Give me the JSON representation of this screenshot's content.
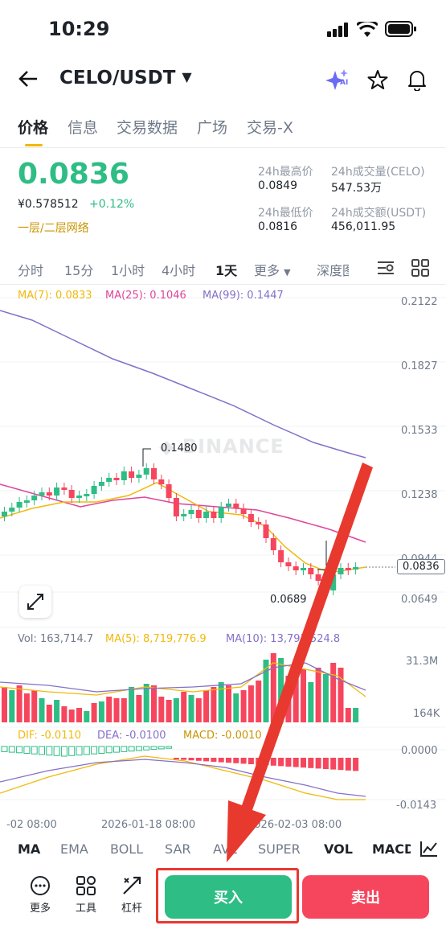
{
  "status": {
    "time": "10:29"
  },
  "header": {
    "pair": "CELO/USDT",
    "dropdown_icon": "caret-down-icon",
    "ai_badge": "AI"
  },
  "tabs": [
    "价格",
    "信息",
    "交易数据",
    "广场",
    "交易-X"
  ],
  "market": {
    "price": "0.0836",
    "cny_price": "¥0.578512",
    "change": "+0.12%",
    "network": "一层/二层网络",
    "high_label": "24h最高价",
    "high_value": "0.0849",
    "low_label": "24h最低价",
    "low_value": "0.0816",
    "vol_celo_label": "24h成交量(CELO)",
    "vol_celo_value": "547.53万",
    "vol_usdt_label": "24h成交额(USDT)",
    "vol_usdt_value": "456,011.95"
  },
  "timeframes": [
    "分时",
    "15分",
    "1小时",
    "4小时",
    "1天",
    "更多",
    "深度图"
  ],
  "chart": {
    "ma_legend": {
      "ma7": "MA(7): 0.0833",
      "ma25": "MA(25): 0.1046",
      "ma99": "MA(99): 0.1447"
    },
    "price_axis": [
      "0.2122",
      "0.1827",
      "0.1533",
      "0.1238",
      "0.0944",
      "0.0649"
    ],
    "current_price_tag": "0.0836",
    "high_marker": "0.1480",
    "low_marker": "0.0689",
    "watermark": "BINANCE",
    "vol_legend": {
      "vol": "Vol: 163,714.7",
      "ma5": "MA(5): 8,719,776.9",
      "ma10": "MA(10): 13,793,524.8"
    },
    "vol_axis": [
      "31.3M",
      "164K"
    ],
    "macd_legend": {
      "dif": "DIF: -0.0110",
      "dea": "DEA: -0.0100",
      "macd": "MACD: -0.0010"
    },
    "macd_axis": [
      "0.0000",
      "-0.0143"
    ],
    "time_axis": [
      "-02 08:00",
      "2026-01-18 08:00",
      "2026-02-03 08:00"
    ]
  },
  "indicators": [
    "MA",
    "EMA",
    "BOLL",
    "SAR",
    "AVL",
    "SUPER",
    "VOL",
    "MACD"
  ],
  "toolbar": {
    "more": "更多",
    "tools": "工具",
    "leverage": "杠杆"
  },
  "actions": {
    "buy": "买入",
    "sell": "卖出"
  },
  "colors": {
    "up": "#2ebd85",
    "down": "#f6465d",
    "accent": "#f0b90b",
    "arrow": "#e8392f"
  }
}
